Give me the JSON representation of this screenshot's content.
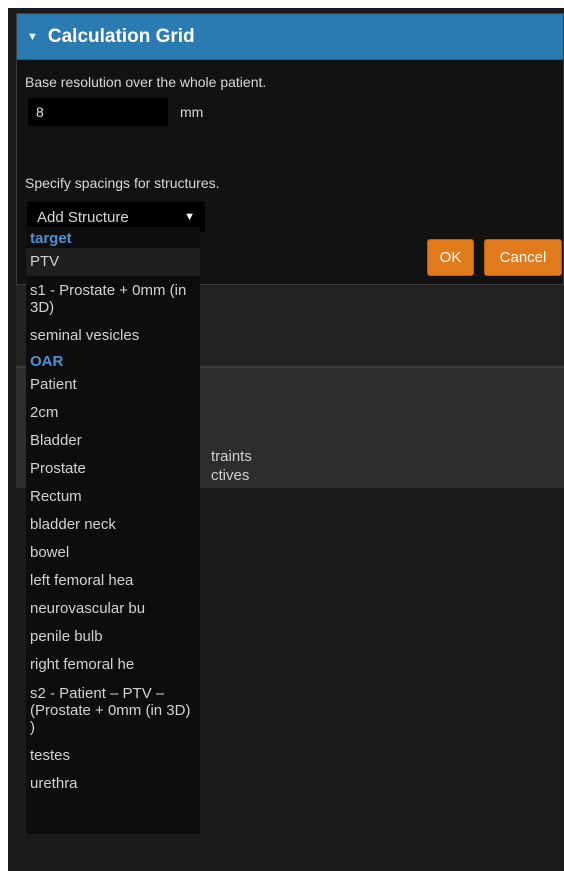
{
  "panel": {
    "title": "Calculation Grid",
    "base_resolution_label": "Base resolution over the whole patient.",
    "resolution_value": "8",
    "unit": "mm",
    "spacing_label": "Specify spacings for structures.",
    "select_label": "Add Structure",
    "ok_label": "OK",
    "cancel_label": "Cancel"
  },
  "background": {
    "partial_line1": "traints",
    "partial_line2": "ctives"
  },
  "dropdown": {
    "group_target": "target",
    "target_items": [
      "PTV",
      "s1 - Prostate + 0mm (in 3D)",
      "seminal vesicles"
    ],
    "group_oar": "OAR",
    "oar_items": [
      "Patient",
      "2cm",
      "Bladder",
      "Prostate",
      "Rectum",
      "bladder neck",
      "bowel",
      "left femoral hea",
      "neurovascular bu",
      "penile bulb",
      "right femoral he",
      "s2 - Patient – PTV – (Prostate + 0mm (in 3D) )",
      "testes",
      "urethra"
    ]
  }
}
